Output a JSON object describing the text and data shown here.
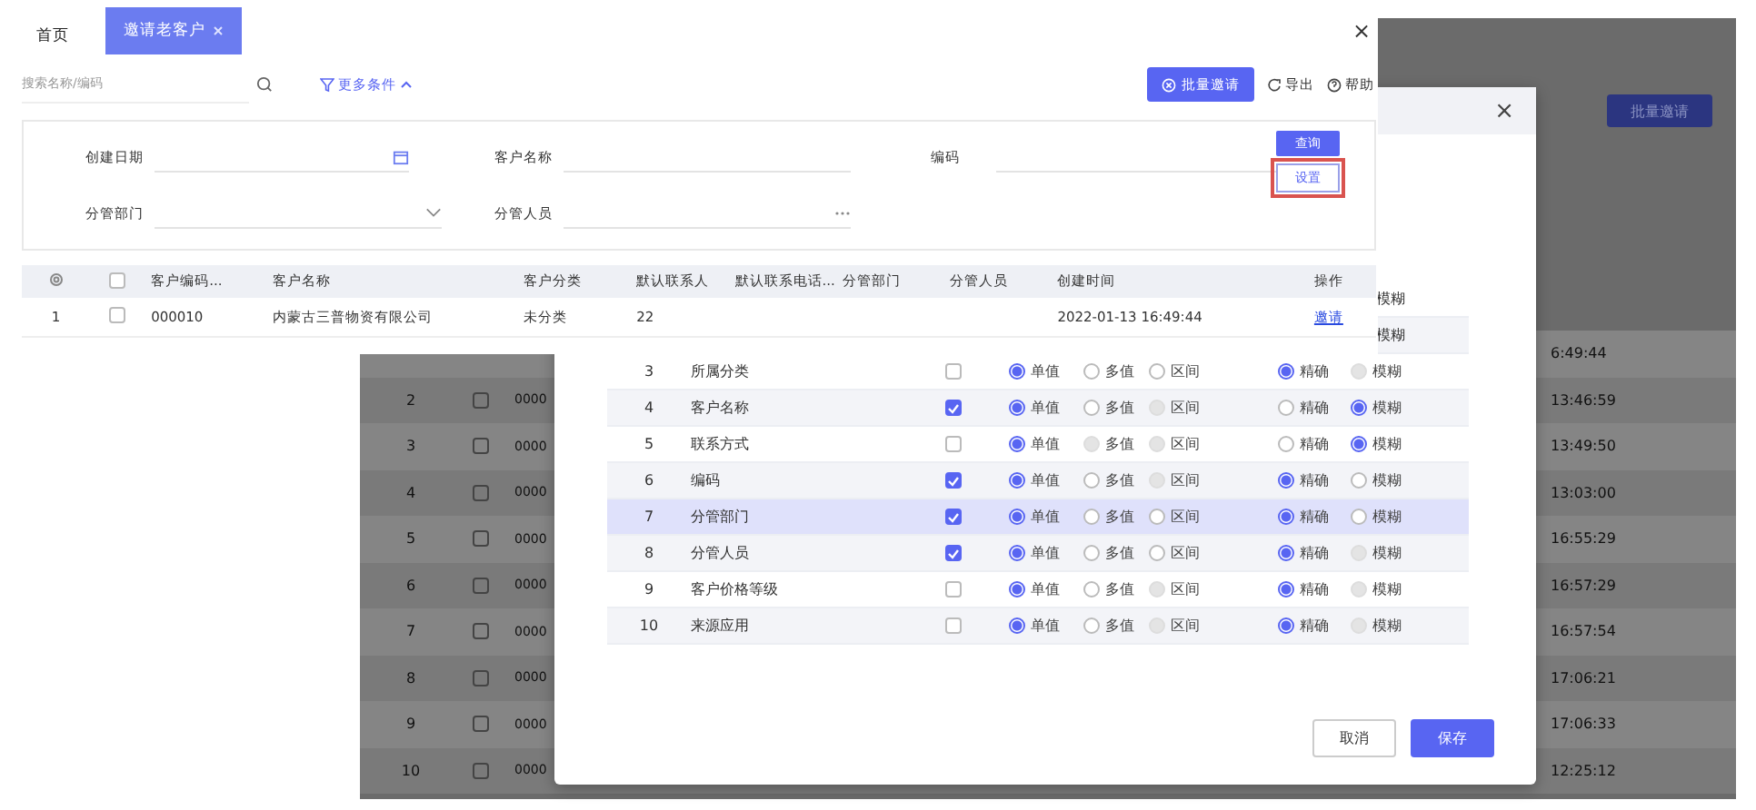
{
  "back_screen": {
    "batch_button": "批量邀请",
    "rows": [
      {
        "time": "6:49:44"
      },
      {
        "num": "2",
        "checked": false,
        "code": "0000",
        "time": "13:46:59"
      },
      {
        "num": "3",
        "checked": false,
        "code": "0000",
        "time": "13:49:50"
      },
      {
        "num": "4",
        "checked": false,
        "code": "0000",
        "time": "13:03:00"
      },
      {
        "num": "5",
        "checked": false,
        "code": "0000",
        "time": "16:55:29"
      },
      {
        "num": "6",
        "checked": false,
        "code": "0000",
        "time": "16:57:29"
      },
      {
        "num": "7",
        "checked": false,
        "code": "0000",
        "time": "16:57:54"
      },
      {
        "num": "8",
        "checked": false,
        "code": "0000",
        "time": "17:06:21"
      },
      {
        "num": "9",
        "checked": false,
        "code": "0000",
        "time": "17:06:33"
      },
      {
        "num": "10",
        "checked": false,
        "code": "0000",
        "time": "12:25:12"
      }
    ]
  },
  "dialog": {
    "peek_rows": [
      "模糊",
      "模糊"
    ],
    "rows": [
      {
        "num": "3",
        "name": "所属分类",
        "checked": false,
        "selected": false,
        "mode": [
          {
            "label": "单值",
            "selected": true,
            "disabled": false
          },
          {
            "label": "多值",
            "selected": false,
            "disabled": false
          },
          {
            "label": "区间",
            "selected": false,
            "disabled": false
          }
        ],
        "match": [
          {
            "label": "精确",
            "selected": true,
            "disabled": false
          },
          {
            "label": "模糊",
            "selected": false,
            "disabled": true
          }
        ]
      },
      {
        "num": "4",
        "name": "客户名称",
        "checked": true,
        "selected": false,
        "mode": [
          {
            "label": "单值",
            "selected": true,
            "disabled": false
          },
          {
            "label": "多值",
            "selected": false,
            "disabled": false
          },
          {
            "label": "区间",
            "selected": false,
            "disabled": true
          }
        ],
        "match": [
          {
            "label": "精确",
            "selected": false,
            "disabled": false
          },
          {
            "label": "模糊",
            "selected": true,
            "disabled": false
          }
        ]
      },
      {
        "num": "5",
        "name": "联系方式",
        "checked": false,
        "selected": false,
        "mode": [
          {
            "label": "单值",
            "selected": true,
            "disabled": false
          },
          {
            "label": "多值",
            "selected": false,
            "disabled": true
          },
          {
            "label": "区间",
            "selected": false,
            "disabled": true
          }
        ],
        "match": [
          {
            "label": "精确",
            "selected": false,
            "disabled": false
          },
          {
            "label": "模糊",
            "selected": true,
            "disabled": false
          }
        ]
      },
      {
        "num": "6",
        "name": "编码",
        "checked": true,
        "selected": false,
        "mode": [
          {
            "label": "单值",
            "selected": true,
            "disabled": false
          },
          {
            "label": "多值",
            "selected": false,
            "disabled": false
          },
          {
            "label": "区间",
            "selected": false,
            "disabled": true
          }
        ],
        "match": [
          {
            "label": "精确",
            "selected": true,
            "disabled": false
          },
          {
            "label": "模糊",
            "selected": false,
            "disabled": false
          }
        ]
      },
      {
        "num": "7",
        "name": "分管部门",
        "checked": true,
        "selected": true,
        "mode": [
          {
            "label": "单值",
            "selected": true,
            "disabled": false
          },
          {
            "label": "多值",
            "selected": false,
            "disabled": false
          },
          {
            "label": "区间",
            "selected": false,
            "disabled": false
          }
        ],
        "match": [
          {
            "label": "精确",
            "selected": true,
            "disabled": false
          },
          {
            "label": "模糊",
            "selected": false,
            "disabled": false
          }
        ]
      },
      {
        "num": "8",
        "name": "分管人员",
        "checked": true,
        "selected": false,
        "mode": [
          {
            "label": "单值",
            "selected": true,
            "disabled": false
          },
          {
            "label": "多值",
            "selected": false,
            "disabled": false
          },
          {
            "label": "区间",
            "selected": false,
            "disabled": false
          }
        ],
        "match": [
          {
            "label": "精确",
            "selected": true,
            "disabled": false
          },
          {
            "label": "模糊",
            "selected": false,
            "disabled": true
          }
        ]
      },
      {
        "num": "9",
        "name": "客户价格等级",
        "checked": false,
        "selected": false,
        "mode": [
          {
            "label": "单值",
            "selected": true,
            "disabled": false
          },
          {
            "label": "多值",
            "selected": false,
            "disabled": false
          },
          {
            "label": "区间",
            "selected": false,
            "disabled": true
          }
        ],
        "match": [
          {
            "label": "精确",
            "selected": true,
            "disabled": false
          },
          {
            "label": "模糊",
            "selected": false,
            "disabled": true
          }
        ]
      },
      {
        "num": "10",
        "name": "来源应用",
        "checked": false,
        "selected": false,
        "mode": [
          {
            "label": "单值",
            "selected": true,
            "disabled": false
          },
          {
            "label": "多值",
            "selected": false,
            "disabled": false
          },
          {
            "label": "区间",
            "selected": false,
            "disabled": true
          }
        ],
        "match": [
          {
            "label": "精确",
            "selected": true,
            "disabled": false
          },
          {
            "label": "模糊",
            "selected": false,
            "disabled": true
          }
        ]
      }
    ],
    "buttons": {
      "cancel": "取消",
      "save": "保存"
    }
  },
  "front": {
    "tabs": [
      {
        "label": "首页",
        "selected": false,
        "closable": false
      },
      {
        "label": "邀请老客户",
        "selected": true,
        "closable": true
      }
    ],
    "close": "×",
    "search": {
      "placeholder": "搜索名称/编码"
    },
    "more_filters": "更多条件",
    "actions": {
      "batch": "批量邀请",
      "export": "导出",
      "help": "帮助"
    },
    "filters": [
      {
        "label": "创建日期",
        "kind": "date"
      },
      {
        "label": "客户名称",
        "kind": "text"
      },
      {
        "label": "编码",
        "kind": "text"
      },
      {
        "label": "分管部门",
        "kind": "select"
      },
      {
        "label": "分管人员",
        "kind": "lookup"
      }
    ],
    "query_button": "查询",
    "settings_button": "设置",
    "table": {
      "select_all_checked": false,
      "columns": [
        "客户编码...",
        "客户名称",
        "客户分类",
        "默认联系人",
        "默认联系电话...",
        "分管部门",
        "分管人员",
        "创建时间",
        "操作"
      ],
      "rows": [
        {
          "num": "1",
          "checked": false,
          "cells": [
            "000010",
            "内蒙古三普物资有限公司",
            "未分类",
            "22",
            "",
            "",
            "",
            "2022-01-13 16:49:44"
          ],
          "action": "邀请"
        }
      ]
    }
  }
}
